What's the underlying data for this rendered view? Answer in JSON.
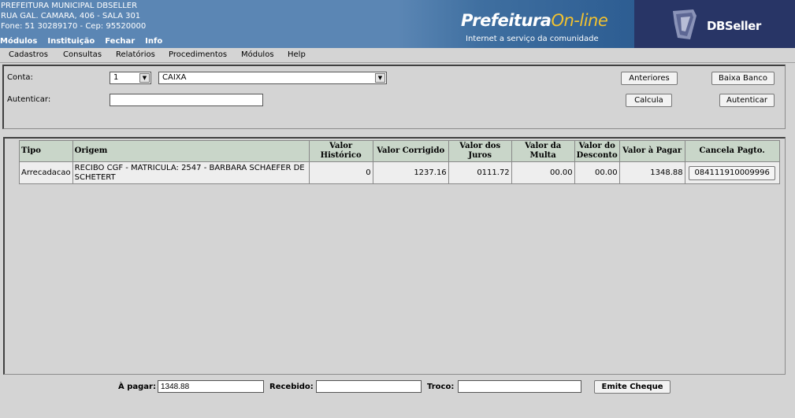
{
  "header": {
    "line1": "PREFEITURA MUNICIPAL DBSELLER",
    "line2": "RUA GAL. CAMARA, 406 - SALA 301",
    "line3": "Fone: 51 30289170  -  Cep: 95520000",
    "top_menu": [
      "Módulos",
      "Instituição",
      "Fechar",
      "Info"
    ],
    "portal_name_a": "Prefeitura",
    "portal_name_b": "On-line",
    "portal_tagline": "Internet a serviço da comunidade",
    "vendor": "DBSeller"
  },
  "menubar": [
    "Cadastros",
    "Consultas",
    "Relatórios",
    "Procedimentos",
    "Módulos",
    "Help"
  ],
  "form": {
    "conta_label": "Conta:",
    "conta_code": "1",
    "conta_name": "CAIXA",
    "autenticar_label": "Autenticar:",
    "autenticar_value": "",
    "anteriores_label": "Anteriores",
    "baixa_banco_label": "Baixa Banco",
    "calcula_label": "Calcula",
    "autenticar_button_label": "Autenticar"
  },
  "table": {
    "columns": [
      "Tipo",
      "Origem",
      "Valor Histórico",
      "Valor Corrigido",
      "Valor dos Juros",
      "Valor da Multa",
      "Valor do Desconto",
      "Valor à Pagar",
      "Cancela Pagto."
    ],
    "rows": [
      {
        "tipo": "Arrecadacao",
        "origem": "RECIBO CGF - MATRICULA: 2547 - BARBARA SCHAEFER DE SCHETERT",
        "valor_historico": "0",
        "valor_corrigido": "1237.16",
        "valor_juros": "0111.72",
        "valor_multa": "00.00",
        "valor_desconto": "00.00",
        "valor_pagar": "1348.88",
        "cancela": "084111910009996"
      }
    ]
  },
  "footer": {
    "a_pagar_label": "À pagar:",
    "a_pagar_value": "1348.88",
    "recebido_label": "Recebido:",
    "recebido_value": "",
    "troco_label": "Troco:",
    "troco_value": "",
    "emite_cheque_label": "Emite Cheque"
  },
  "colors": {
    "header_bg": "#5b86b4",
    "vendor_bg": "#283566",
    "table_header_bg": "#c9d6c9",
    "page_bg": "#d4d4d4",
    "logo_accent": "#f2c230"
  }
}
